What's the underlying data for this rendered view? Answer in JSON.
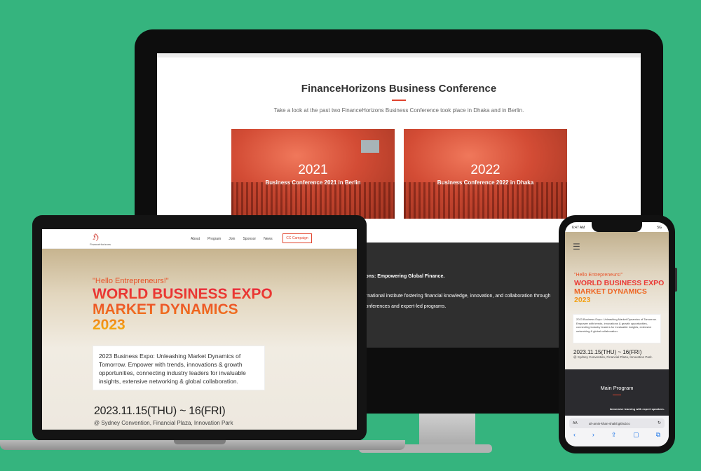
{
  "desktop": {
    "title": "FinanceHorizons Business Conference",
    "subtitle": "Take a look at the past two FinanceHorizons Business Conference took place in Dhaka and in Berlin.",
    "cards": [
      {
        "year": "2021",
        "label": "Business Conference 2021 in Berlin"
      },
      {
        "year": "2022",
        "label": "Business Conference 2022 in Dhaka"
      }
    ],
    "footer": {
      "line1": "zons: Empowering Global Finance.",
      "line2": "ernational institute fostering financial knowledge, innovation, and collaboration through",
      "line3": "conferences and expert-led programs."
    }
  },
  "laptop": {
    "logo_text": "FinanceHorizons",
    "nav": [
      "About",
      "Program",
      "Join",
      "Sponsor",
      "News"
    ],
    "cta": "CC Campaign",
    "hello": "\"Hello Entrepreneurs!\"",
    "title_line1": "WORLD BUSINESS EXPO",
    "title_line2": "MARKET DYNAMICS",
    "title_line3": "2023",
    "description": "2023 Business Expo: Unleashing Market Dynamics of Tomorrow. Empower with trends, innovations & growth opportunities, connecting industry leaders for invaluable insights, extensive networking & global collaboration.",
    "date": "2023.11.15(THU) ~ 16(FRI)",
    "venue": "@ Sydney Convention, Financial Plaza, Innovation Park"
  },
  "phone": {
    "time": "6:47 AM",
    "signal": "5G",
    "hello": "\"Hello Entrepreneurs!\"",
    "title_line1": "WORLD BUSINESS EXPO",
    "title_line2": "MARKET DYNAMICS",
    "title_line3": "2023",
    "description": "2023 Business Expo: Unleashing Market Dynamics of Tomorrow. Empower with trends, innovations & growth opportunities, connecting industry leaders for invaluable insights, extensive networking & global collaboration.",
    "date": "2023.11.15(THU) ~ 16(FRI)",
    "venue": "@ Sydney Convention, Financial Plaza, Innovation Park.",
    "section_title": "Main Program",
    "section_caption": "Immersive learning with expert speakers.",
    "browser": {
      "aa": "AA",
      "url": "ah-amin-khan-shakil.github.io",
      "reload_icon": "↻",
      "tools": [
        "‹",
        "›",
        "⇪",
        "▢",
        "⧉"
      ]
    }
  },
  "colors": {
    "background": "#35b47e",
    "accent": "#e0432e"
  }
}
